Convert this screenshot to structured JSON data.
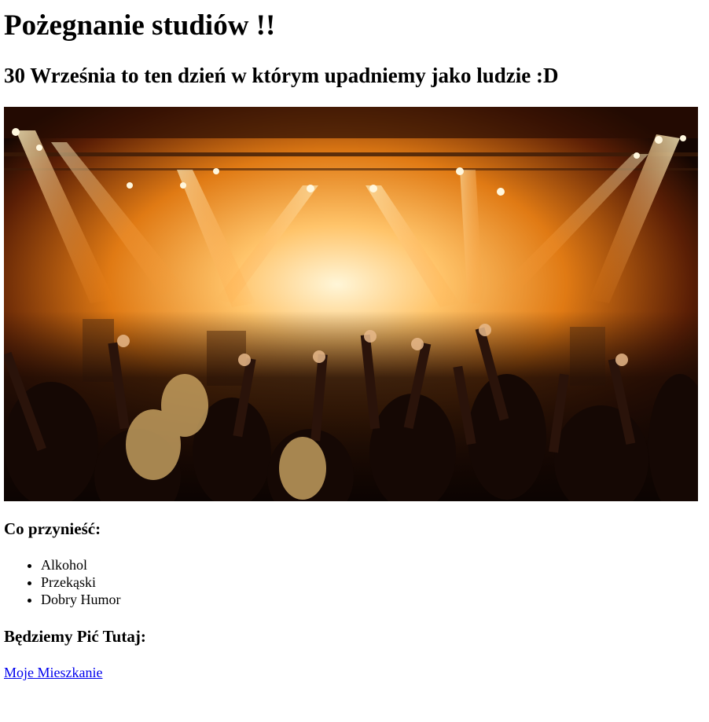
{
  "header": {
    "title": "Pożegnanie studiów !!",
    "subtitle": "30 Września to ten dzień w którym upadniemy jako ludzie :D"
  },
  "hero_image": {
    "description_icon": "concert-crowd-image",
    "colors": {
      "glow": "#ffb347",
      "hot": "#fff2c0",
      "dark": "#140602"
    }
  },
  "bring": {
    "heading": "Co przynieść:",
    "items": [
      {
        "label": "Alkohol"
      },
      {
        "label": "Przekąski"
      },
      {
        "label": "Dobry Humor"
      }
    ]
  },
  "location": {
    "heading": "Będziemy Pić Tutaj:",
    "link_label": "Moje Mieszkanie",
    "link_color": "#0000ee"
  }
}
